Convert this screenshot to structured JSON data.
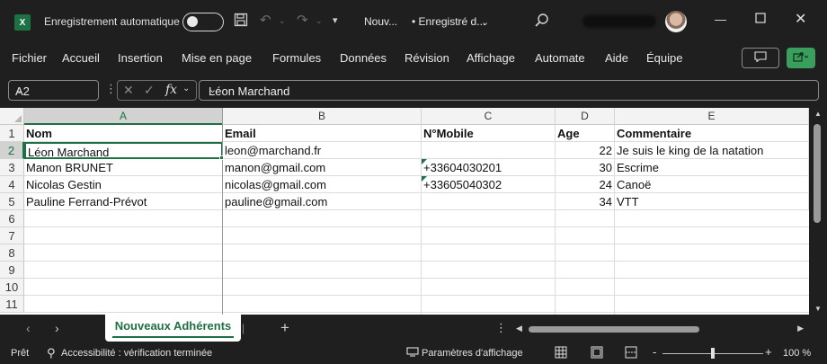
{
  "titlebar": {
    "app_icon": "excel-icon",
    "autosave_label": "Enregistrement automatique",
    "doc_name": "Nouv...",
    "doc_status": "• Enregistré d..."
  },
  "menu": {
    "items": [
      "Fichier",
      "Accueil",
      "Insertion",
      "Mise en page",
      "Formules",
      "Données",
      "Révision",
      "Affichage",
      "Automate",
      "Aide",
      "Équipe"
    ]
  },
  "formula_bar": {
    "name_box": "A2",
    "fx_label": "fx",
    "content": "Léon Marchand"
  },
  "grid": {
    "columns": [
      "A",
      "B",
      "C",
      "D",
      "E"
    ],
    "row_numbers": [
      "1",
      "2",
      "3",
      "4",
      "5",
      "6",
      "7",
      "8",
      "9",
      "10",
      "11"
    ],
    "header": [
      "Nom",
      "Email",
      "N°Mobile",
      "Age",
      "Commentaire"
    ],
    "rows": [
      [
        "Léon Marchand",
        "leon@marchand.fr",
        "",
        "22",
        "Je suis le king de la natation"
      ],
      [
        "Manon BRUNET",
        "manon@gmail.com",
        "+33604030201",
        "30",
        "Escrime"
      ],
      [
        "Nicolas Gestin",
        "nicolas@gmail.com",
        "+33605040302",
        "24",
        "Canoë"
      ],
      [
        "Pauline Ferrand-Prévot",
        "pauline@gmail.com",
        "",
        "34",
        "VTT"
      ]
    ]
  },
  "sheet_tabs": {
    "active": "Nouveaux Adhérents",
    "add_label": "+"
  },
  "statusbar": {
    "ready": "Prêt",
    "accessibility": "Accessibilité : vérification terminée",
    "display_settings": "Paramètres d'affichage",
    "zoom_minus": "-",
    "zoom_plus": "+",
    "zoom": "100 %"
  },
  "colors": {
    "excel_green": "#1e7145",
    "share_green": "#3a9e5c",
    "chrome_bg": "#1f1f1f"
  }
}
